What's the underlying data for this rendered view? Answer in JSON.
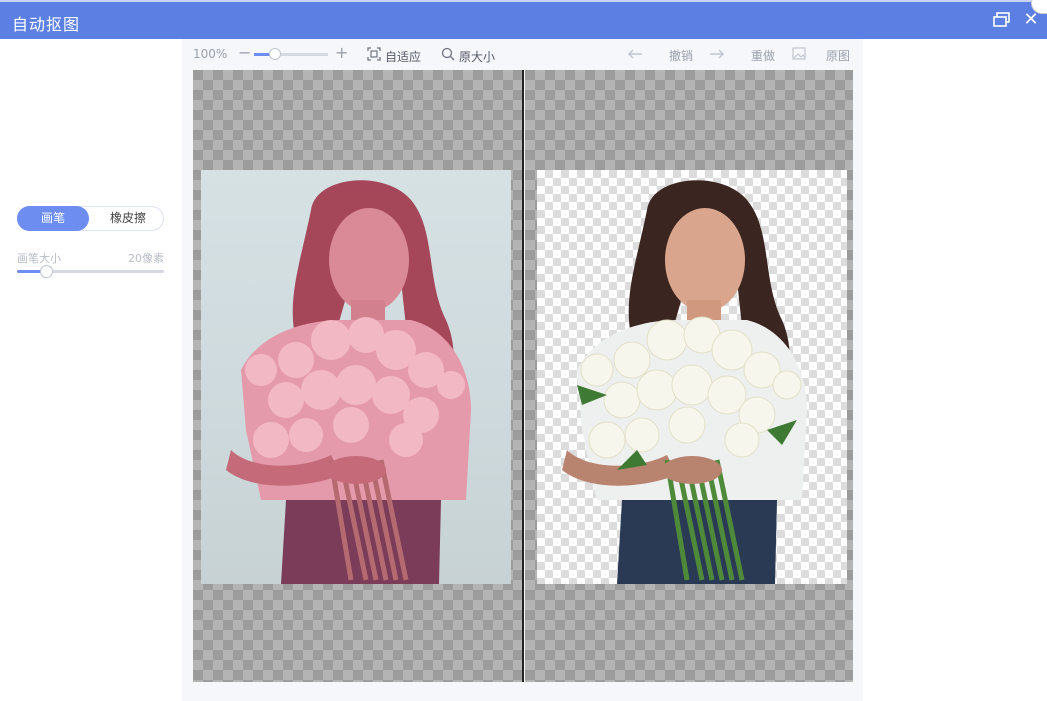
{
  "window": {
    "title": "自动抠图",
    "restore_icon": "restore-window-icon",
    "close_glyph": "✕",
    "close_icon": "close-icon"
  },
  "tools": {
    "brush_label": "画笔",
    "eraser_label": "橡皮擦",
    "active": "画笔",
    "brush_size_label": "画笔大小",
    "brush_size_value": "20像素",
    "brush_size_fraction": 0.2
  },
  "toolbar": {
    "zoom_text": "100%",
    "zoom_minus": "−",
    "zoom_plus": "+",
    "zoom_fraction": 0.28,
    "fit_label": "自适应",
    "fit_icon": "fit-screen-icon",
    "original_size_label": "原大小",
    "original_size_icon": "zoom-icon",
    "undo_label": "撤销",
    "undo_icon": "arrow-left-icon",
    "redo_label": "重做",
    "redo_icon": "arrow-right-icon",
    "original_label": "原图",
    "original_icon": "image-icon"
  },
  "canvas": {
    "left_tint": "#d9607a",
    "mask_color": "#e06b86",
    "background_grey": "#9c9c9c",
    "accent": "#6d8ef0",
    "titlebar_color": "#5b7fe3"
  }
}
